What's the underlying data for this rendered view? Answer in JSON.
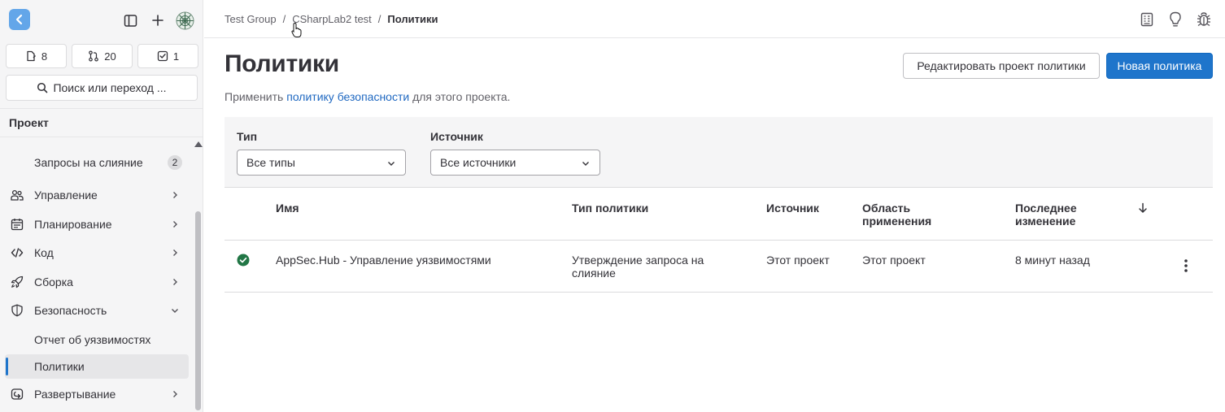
{
  "sidebar": {
    "counters": [
      {
        "icon": "issues-icon",
        "count": "8"
      },
      {
        "icon": "merge-request-icon",
        "count": "20"
      },
      {
        "icon": "todo-icon",
        "count": "1"
      }
    ],
    "search_label": "Поиск или переход ...",
    "section_title": "Проект",
    "items": [
      {
        "label": "Запросы на слияние",
        "badge": "2"
      },
      {
        "label": "Управление"
      },
      {
        "label": "Планирование"
      },
      {
        "label": "Код"
      },
      {
        "label": "Сборка"
      },
      {
        "label": "Безопасность"
      },
      {
        "label": "Отчет об уязвимостях"
      },
      {
        "label": "Политики"
      },
      {
        "label": "Развертывание"
      }
    ]
  },
  "breadcrumb": {
    "group": "Test Group",
    "project": "CSharpLab2 test",
    "current": "Политики",
    "separator": "/"
  },
  "page": {
    "title": "Политики",
    "desc_prefix": "Применить ",
    "desc_link": "политику безопасности",
    "desc_suffix": " для этого проекта.",
    "edit_button": "Редактировать проект политики",
    "new_button": "Новая политика"
  },
  "filters": {
    "type_label": "Тип",
    "type_value": "Все типы",
    "source_label": "Источник",
    "source_value": "Все источники"
  },
  "table": {
    "headers": {
      "name": "Имя",
      "policy_type": "Тип политики",
      "source": "Источник",
      "scope_line1": "Область",
      "scope_line2": "применения",
      "modified_line1": "Последнее",
      "modified_line2": "изменение"
    },
    "rows": [
      {
        "name": "AppSec.Hub - Управление уязвимостями",
        "type_line1": "Утверждение запроса на",
        "type_line2": "слияние",
        "source": "Этот проект",
        "scope": "Этот проект",
        "modified": "8 минут назад"
      }
    ]
  },
  "colors": {
    "accent": "#1f75cb",
    "success": "#217645",
    "link": "#1f68c1"
  }
}
